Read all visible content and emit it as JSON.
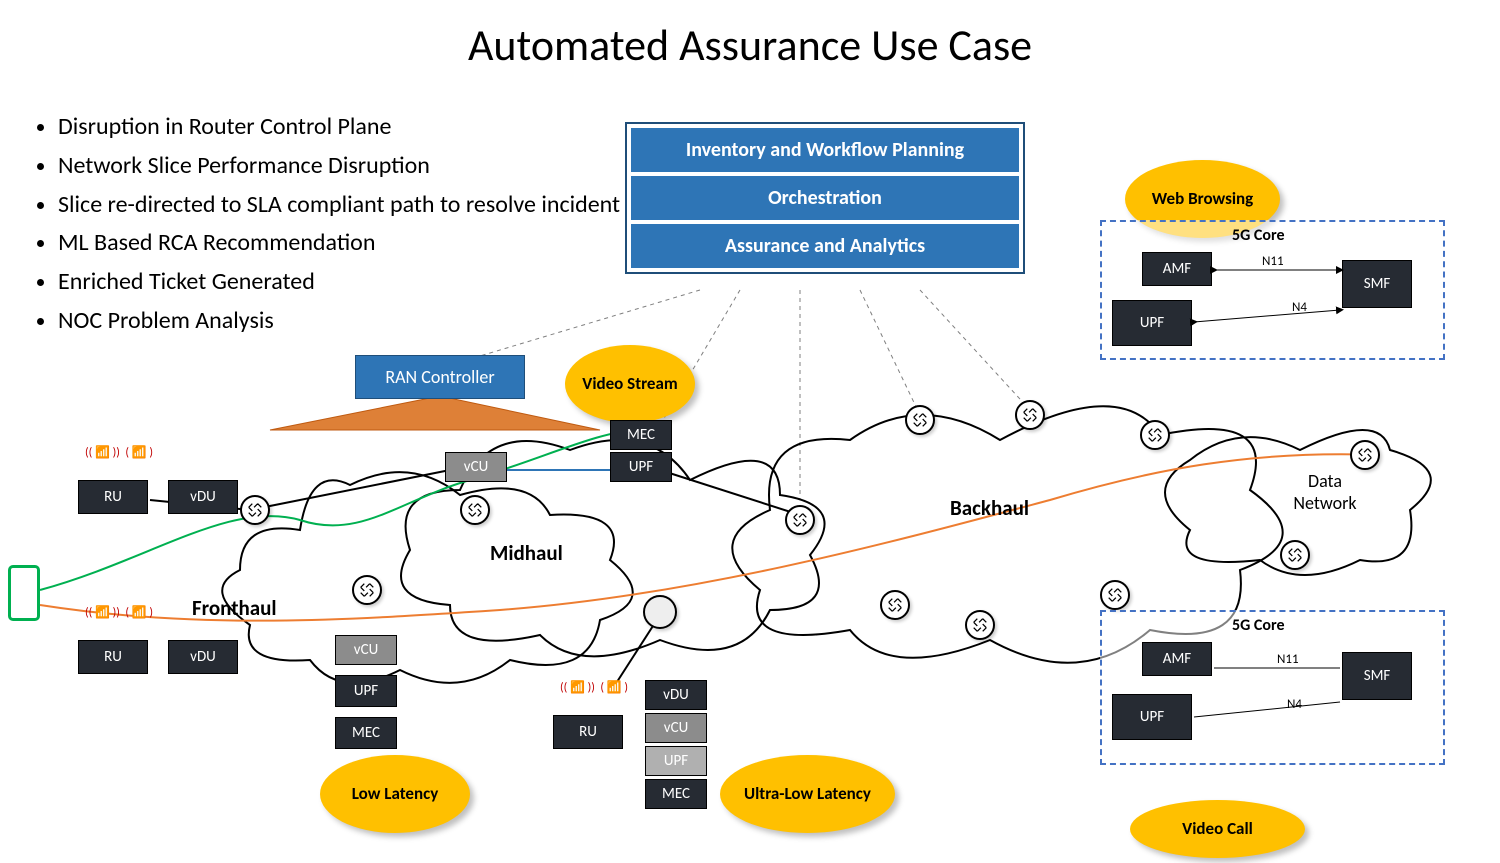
{
  "title": "Automated Assurance Use Case",
  "bullets": [
    "Disruption in Router Control Plane",
    "Network Slice Performance  Disruption",
    "Slice re-directed to SLA compliant path to resolve incident",
    "ML Based RCA Recommendation",
    "Enriched Ticket Generated",
    "NOC Problem Analysis"
  ],
  "stack": {
    "row1": "Inventory and Workflow Planning",
    "row2": "Orchestration",
    "row3": "Assurance and Analytics"
  },
  "ran_controller": "RAN Controller",
  "ovals": {
    "video_stream": "Video Stream",
    "web_browsing": "Web Browsing",
    "low_latency": "Low Latency",
    "ultra_low_latency": "Ultra-Low Latency",
    "video_call": "Video Call"
  },
  "nodes": {
    "ru": "RU",
    "vdu": "vDU",
    "vcu": "vCU",
    "upf": "UPF",
    "mec": "MEC",
    "amf": "AMF",
    "smf": "SMF"
  },
  "clouds": {
    "fronthaul": "Fronthaul",
    "midhaul": "Midhaul",
    "backhaul": "Backhaul",
    "data_network": "Data Network"
  },
  "core": {
    "title": "5G Core",
    "n11": "N11",
    "n4": "N4"
  }
}
